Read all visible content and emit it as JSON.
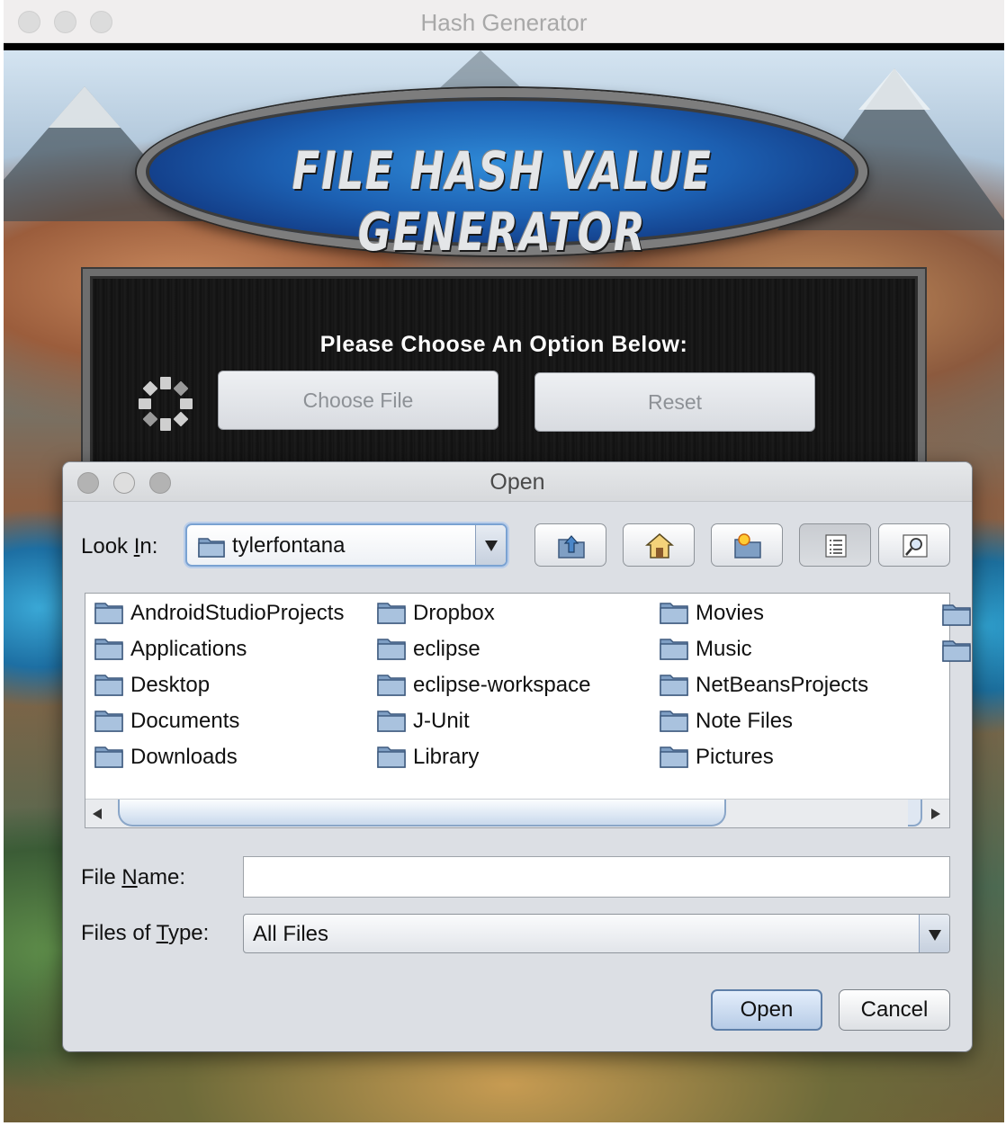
{
  "app": {
    "window_title": "Hash Generator",
    "banner_title": "FILE HASH VALUE GENERATOR",
    "panel_heading": "Please Choose An Option Below:",
    "choose_file_label": "Choose File",
    "reset_label": "Reset"
  },
  "dialog": {
    "title": "Open",
    "look_in_label": "Look In:",
    "look_in_value": "tylerfontana",
    "toolbar": [
      "up-one-level-icon",
      "home-icon",
      "new-folder-icon",
      "list-view-icon",
      "details-view-icon"
    ],
    "files": [
      "AndroidStudioProjects",
      "Applications",
      "Desktop",
      "Documents",
      "Downloads",
      "Dropbox",
      "eclipse",
      "eclipse-workspace",
      "J-Unit",
      "Library",
      "Movies",
      "Music",
      "NetBeansProjects",
      "Note Files",
      "Pictures"
    ],
    "file_name_label": "File Name:",
    "file_name_value": "",
    "files_of_type_label": "Files of Type:",
    "files_of_type_value": "All Files",
    "open_label": "Open",
    "cancel_label": "Cancel"
  },
  "colors": {
    "banner_blue": "#1c5fb1",
    "dialog_bg": "#dcdfe4",
    "focus_ring": "#7aa2d2"
  }
}
